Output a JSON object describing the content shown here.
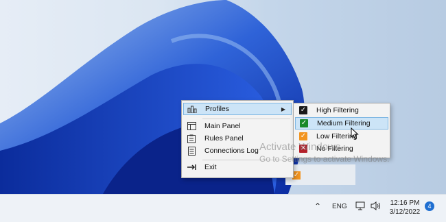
{
  "colors": {
    "accent": "#1f6fd1",
    "highlight": "#cce4f7",
    "check_black": "#1a1a1a",
    "check_green": "#1a8a2a",
    "check_orange": "#f2941f",
    "check_red": "#b3202a"
  },
  "main_menu": {
    "items": [
      {
        "label": "Profiles",
        "icon": "bar-chart-icon",
        "has_submenu": true
      },
      {
        "label": "Main Panel",
        "icon": "panel-icon"
      },
      {
        "label": "Rules Panel",
        "icon": "clipboard-icon"
      },
      {
        "label": "Connections Log",
        "icon": "document-icon"
      },
      {
        "label": "Exit",
        "icon": "exit-arrow-icon"
      }
    ]
  },
  "profiles_submenu": {
    "items": [
      {
        "label": "High Filtering",
        "icon": "check-black-icon"
      },
      {
        "label": "Medium Filtering",
        "icon": "check-green-icon"
      },
      {
        "label": "Low Filtering",
        "icon": "check-orange-icon"
      },
      {
        "label": "No Filtering",
        "icon": "x-red-icon"
      }
    ]
  },
  "watermark": {
    "title": "Activate Windows",
    "subtitle": "Go to Settings to activate Windows."
  },
  "taskbar": {
    "language": "ENG",
    "time": "12:16 PM",
    "date": "3/12/2022",
    "notification_count": "4"
  }
}
